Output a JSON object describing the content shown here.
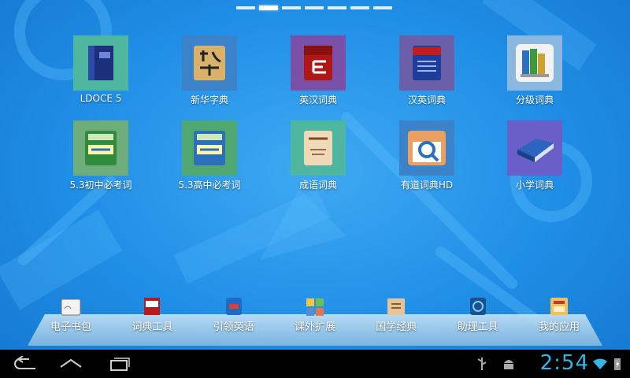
{
  "pager": {
    "page_count": 7,
    "active_index": 1
  },
  "apps": [
    {
      "label": "LDOCE 5",
      "icon": "longman-dictionary-icon",
      "tile_color": "#4fb6a0"
    },
    {
      "label": "新华字典",
      "icon": "xinhua-dictionary-icon",
      "tile_color": "#3b82c8"
    },
    {
      "label": "英汉词典",
      "icon": "english-chinese-dictionary-icon",
      "tile_color": "#7a4fa8"
    },
    {
      "label": "汉英词典",
      "icon": "chinese-english-dictionary-icon",
      "tile_color": "#6a5fa8"
    },
    {
      "label": "分级词典",
      "icon": "graded-dictionary-icon",
      "tile_color": "#8bb8e0"
    },
    {
      "label": "5.3初中必考词",
      "icon": "junior-high-vocab-icon",
      "tile_color": "#6fae7a"
    },
    {
      "label": "5.3高中必考词",
      "icon": "senior-high-vocab-icon",
      "tile_color": "#4fa86f"
    },
    {
      "label": "成语词典",
      "icon": "idiom-dictionary-icon",
      "tile_color": "#4fb6a0"
    },
    {
      "label": "有道词典HD",
      "icon": "youdao-dictionary-icon",
      "tile_color": "#3b82c8"
    },
    {
      "label": "小学词典",
      "icon": "primary-school-dictionary-icon",
      "tile_color": "#6a5fc8"
    }
  ],
  "dock": [
    {
      "label": "电子书包",
      "icon": "ebook-bag-icon"
    },
    {
      "label": "词典工具",
      "icon": "dictionary-tools-icon"
    },
    {
      "label": "引领英语",
      "icon": "lead-english-icon"
    },
    {
      "label": "课外扩展",
      "icon": "extracurricular-icon"
    },
    {
      "label": "国学经典",
      "icon": "chinese-classics-icon"
    },
    {
      "label": "助理工具",
      "icon": "assistant-tools-icon"
    },
    {
      "label": "我的应用",
      "icon": "my-apps-icon"
    }
  ],
  "status": {
    "time": "2:54",
    "icons": [
      "usb-icon",
      "android-debug-icon",
      "wifi-icon",
      "battery-charging-icon"
    ]
  },
  "colors": {
    "clock": "#33b5e5",
    "background": "#1f8ee6"
  }
}
